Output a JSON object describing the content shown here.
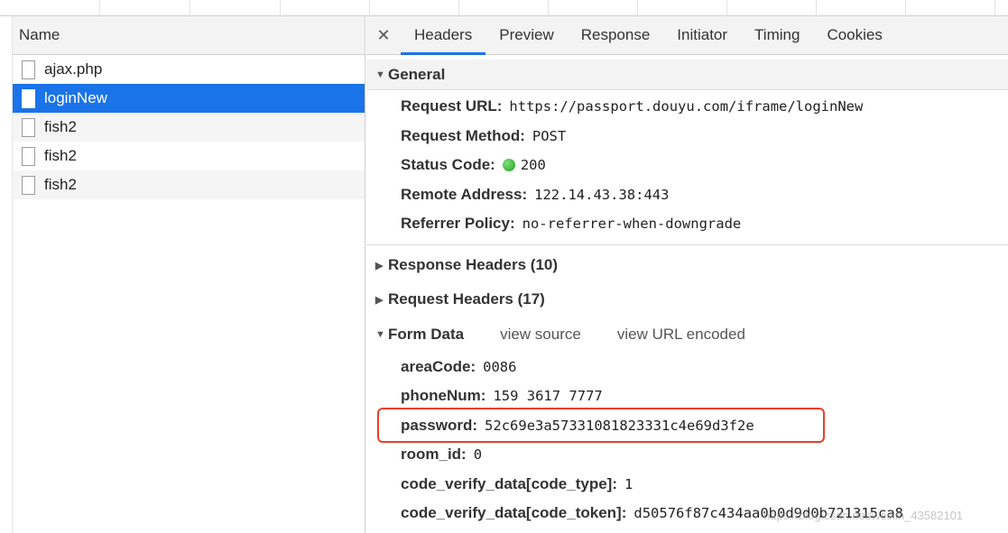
{
  "left_panel": {
    "column_header": "Name",
    "requests": [
      {
        "name": "ajax.php"
      },
      {
        "name": "loginNew",
        "selected": true
      },
      {
        "name": "fish2"
      },
      {
        "name": "fish2"
      },
      {
        "name": "fish2"
      }
    ]
  },
  "tabs": {
    "close_icon": "close-icon",
    "items": [
      {
        "label": "Headers",
        "active": true
      },
      {
        "label": "Preview"
      },
      {
        "label": "Response"
      },
      {
        "label": "Initiator"
      },
      {
        "label": "Timing"
      },
      {
        "label": "Cookies"
      }
    ]
  },
  "general": {
    "title": "General",
    "request_url_label": "Request URL:",
    "request_url": "https://passport.douyu.com/iframe/loginNew",
    "request_method_label": "Request Method:",
    "request_method": "POST",
    "status_code_label": "Status Code:",
    "status_code": "200",
    "status_color": "#1e9e1e",
    "remote_address_label": "Remote Address:",
    "remote_address": "122.14.43.38:443",
    "referrer_policy_label": "Referrer Policy:",
    "referrer_policy": "no-referrer-when-downgrade"
  },
  "response_headers": "Response Headers (10)",
  "request_headers": "Request Headers (17)",
  "form_data": {
    "title": "Form Data",
    "view_source": "view source",
    "view_url_encoded": "view URL encoded",
    "fields": {
      "areaCode_label": "areaCode:",
      "areaCode": "0086",
      "phoneNum_label": "phoneNum:",
      "phoneNum": "159 3617 7777",
      "password_label": "password:",
      "password": "52c69e3a57331081823331c4e69d3f2e",
      "room_id_label": "room_id:",
      "room_id": "0",
      "code_type_label": "code_verify_data[code_type]:",
      "code_type": "1",
      "code_token_label": "code_verify_data[code_token]:",
      "code_token": "d50576f87c434aa0b0d9d0b721315ca8"
    }
  },
  "highlight_color": "#e8402b",
  "selection_color": "#1a73e8",
  "watermark": "https://blog.csdn.net/weixin_43582101"
}
